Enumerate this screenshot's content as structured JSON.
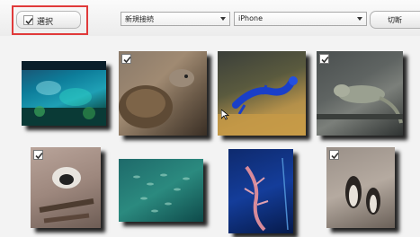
{
  "toolbar": {
    "select_label": "選択",
    "dropdown_device_group": "新規接続",
    "dropdown_device": "iPhone",
    "cut_label": "切断"
  },
  "photos": [
    {
      "name": "aquarium",
      "checked": false
    },
    {
      "name": "tortoise",
      "checked": true
    },
    {
      "name": "blue-lizard",
      "checked": false
    },
    {
      "name": "iguana",
      "checked": true
    },
    {
      "name": "lemur",
      "checked": true
    },
    {
      "name": "fish-school",
      "checked": false
    },
    {
      "name": "seadragon",
      "checked": false
    },
    {
      "name": "penguins",
      "checked": true
    }
  ],
  "colors": {
    "highlight": "#e03a3a"
  }
}
